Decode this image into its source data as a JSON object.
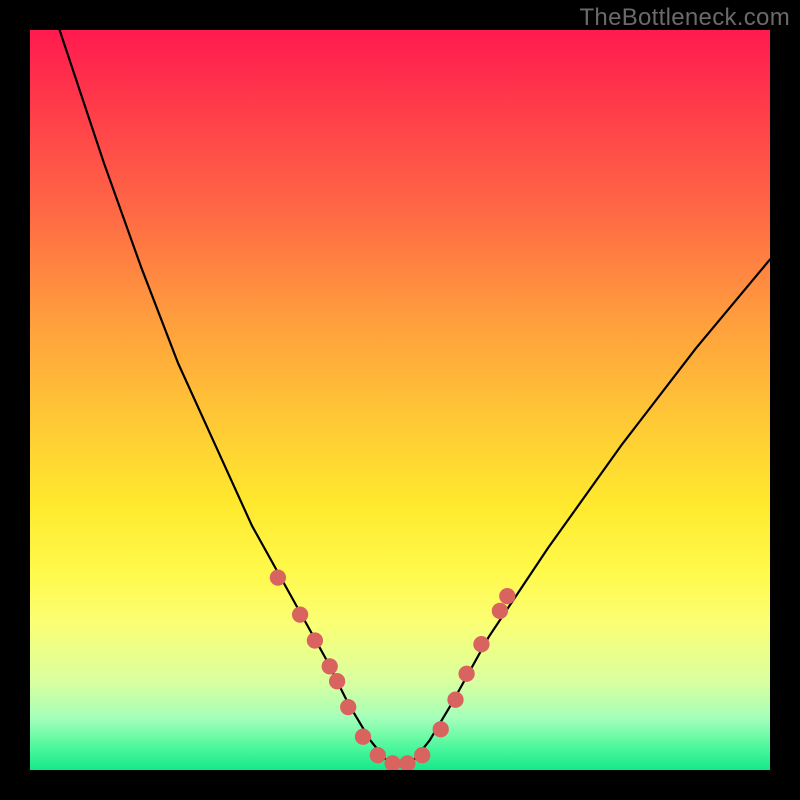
{
  "watermark": "TheBottleneck.com",
  "chart_data": {
    "type": "line",
    "title": "",
    "xlabel": "",
    "ylabel": "",
    "xlim": [
      0,
      100
    ],
    "ylim": [
      0,
      100
    ],
    "grid": false,
    "legend": false,
    "series": [
      {
        "name": "bottleneck-curve",
        "color": "#000000",
        "x": [
          4,
          10,
          15,
          20,
          25,
          30,
          35,
          40,
          43,
          46,
          48,
          50,
          52,
          54,
          57,
          62,
          70,
          80,
          90,
          100
        ],
        "y": [
          100,
          82,
          68,
          55,
          44,
          33,
          24,
          15,
          9,
          4,
          1.5,
          0.8,
          1.5,
          4,
          9,
          18,
          30,
          44,
          57,
          69
        ]
      }
    ],
    "markers": {
      "name": "highlight-points",
      "color": "#d9635e",
      "radius_pct": 1.1,
      "points": [
        {
          "x": 33.5,
          "y": 26
        },
        {
          "x": 36.5,
          "y": 21
        },
        {
          "x": 38.5,
          "y": 17.5
        },
        {
          "x": 40.5,
          "y": 14
        },
        {
          "x": 41.5,
          "y": 12
        },
        {
          "x": 43,
          "y": 8.5
        },
        {
          "x": 45,
          "y": 4.5
        },
        {
          "x": 47,
          "y": 2
        },
        {
          "x": 49,
          "y": 0.9
        },
        {
          "x": 51,
          "y": 0.9
        },
        {
          "x": 53,
          "y": 2
        },
        {
          "x": 55.5,
          "y": 5.5
        },
        {
          "x": 57.5,
          "y": 9.5
        },
        {
          "x": 59,
          "y": 13
        },
        {
          "x": 61,
          "y": 17
        },
        {
          "x": 63.5,
          "y": 21.5
        },
        {
          "x": 64.5,
          "y": 23.5
        }
      ]
    },
    "background_gradient": {
      "top": "#ff1a4f",
      "mid": "#ffe92e",
      "bottom": "#15e88b"
    }
  }
}
